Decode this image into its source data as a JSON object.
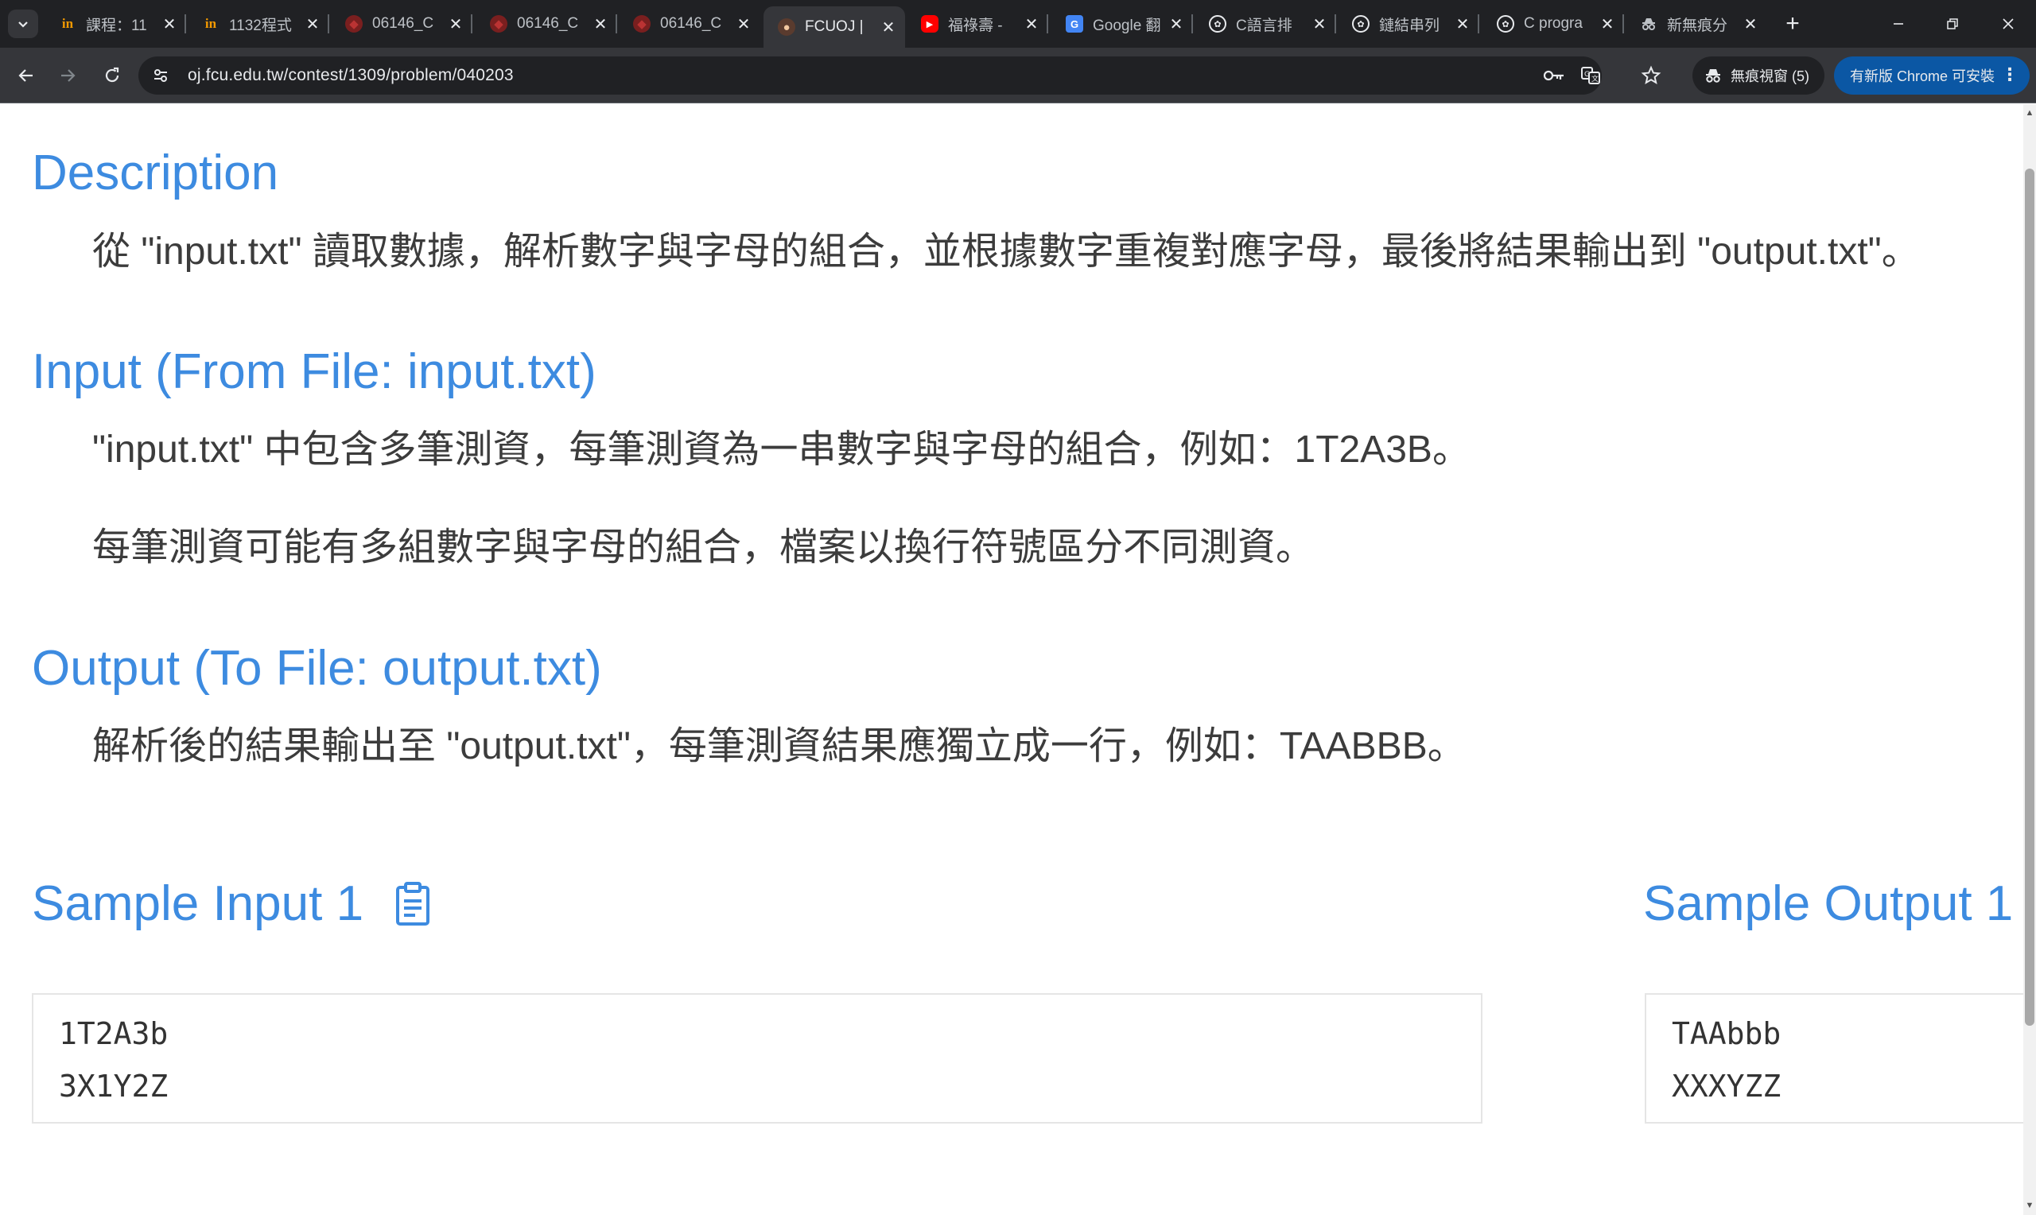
{
  "browser": {
    "tabs": [
      {
        "title": "課程：11",
        "favicon": "in-logo-icon"
      },
      {
        "title": "1132程式",
        "favicon": "in-logo-icon"
      },
      {
        "title": "06146_C",
        "favicon": "shield-icon"
      },
      {
        "title": "06146_C",
        "favicon": "shield-icon"
      },
      {
        "title": "06146_C",
        "favicon": "shield-icon"
      },
      {
        "title": "FCUOJ | ",
        "favicon": "fcu-logo-icon"
      },
      {
        "title": "福祿壽 -",
        "favicon": "youtube-icon"
      },
      {
        "title": "Google 翻",
        "favicon": "google-translate-icon"
      },
      {
        "title": "C語言排",
        "favicon": "chatgpt-icon"
      },
      {
        "title": "鏈結串列",
        "favicon": "chatgpt-icon"
      },
      {
        "title": "C progra",
        "favicon": "chatgpt-icon"
      },
      {
        "title": "新無痕分",
        "favicon": "incognito-icon"
      }
    ],
    "active_tab_index": 5,
    "url": "oj.fcu.edu.tw/contest/1309/problem/040203",
    "incognito_label": "無痕視窗 (5)",
    "update_label": "有新版 Chrome 可安裝"
  },
  "problem": {
    "description_heading": "Description",
    "description_text": "從 \"input.txt\" 讀取數據，解析數字與字母的組合，並根據數字重複對應字母，最後將結果輸出到 \"output.txt\"。",
    "input_heading": "Input (From File: input.txt)",
    "input_text_1": "\"input.txt\" 中包含多筆測資，每筆測資為一串數字與字母的組合，例如：1T2A3B。",
    "input_text_2": "每筆測資可能有多組數字與字母的組合，檔案以換行符號區分不同測資。",
    "output_heading": "Output (To File: output.txt)",
    "output_text": "解析後的結果輸出至 \"output.txt\"，每筆測資結果應獨立成一行，例如：TAABBB。",
    "sample_input_heading": "Sample Input 1",
    "sample_output_heading": "Sample Output 1",
    "sample_input_lines": [
      "1T2A3b",
      "3X1Y2Z"
    ],
    "sample_output_lines": [
      "TAAbbb",
      "XXXYZZ"
    ]
  },
  "colors": {
    "heading": "#3d8be0",
    "body_text": "#3c3c3c",
    "tabstrip_bg": "#202124",
    "toolbar_bg": "#35363a",
    "update_pill_bg": "#0b57a4"
  }
}
